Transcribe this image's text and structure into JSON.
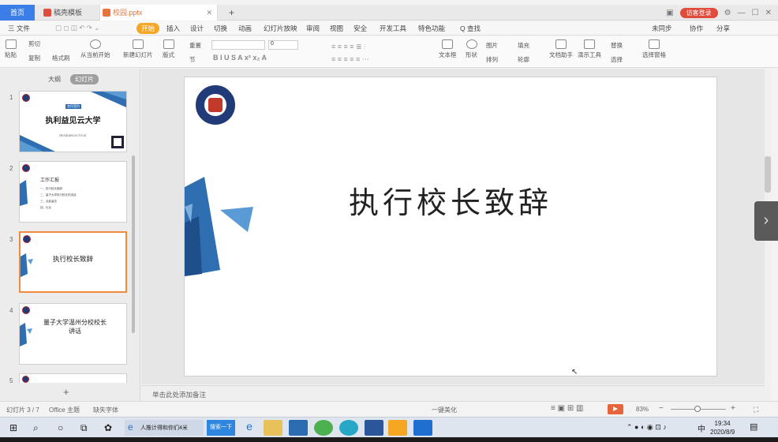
{
  "tabs": {
    "home": "首页",
    "t1": "稿壳模板",
    "t2": "校园.pptx",
    "add": "+"
  },
  "window": {
    "login": "访客登录"
  },
  "menu": {
    "file": "三 文件",
    "start": "开始",
    "items": [
      "插入",
      "设计",
      "切换",
      "动画",
      "幻灯片放映",
      "审阅",
      "视图",
      "安全",
      "开发工具",
      "特色功能",
      "Q 查找"
    ],
    "right": [
      "未同步",
      "协作",
      "分享"
    ]
  },
  "ribbon": {
    "paste": "粘贴",
    "cut": "剪切",
    "copy": "复制",
    "format": "格式刷",
    "from_current": "从当前开始",
    "new_slide": "新建幻灯片",
    "layout": "版式",
    "section": "节",
    "reset": "重置",
    "textbox": "文本框",
    "shape": "形状",
    "arrange": "排列",
    "image": "图片",
    "fill": "填充",
    "outline": "轮廓",
    "doc_helper": "文档助手",
    "presenter": "演示工具",
    "replace": "替换",
    "select": "选择",
    "select_pane": "选择窗格",
    "font_size": "0"
  },
  "panel": {
    "outline": "大纲",
    "slides": "幻灯片"
  },
  "slides": [
    {
      "num": "1",
      "title": "执利益见云大学",
      "tag": "合作签约",
      "sub": "RESEARCH TITLE"
    },
    {
      "num": "2",
      "title": "工作汇报",
      "lines": [
        "一、执行校长致辞",
        "二、量子大学执行校长的讲话",
        "三、合影留念",
        "四、礼仪"
      ]
    },
    {
      "num": "3",
      "title": "执行校长致辞"
    },
    {
      "num": "4",
      "title": "量子大学温州分校校长讲话"
    },
    {
      "num": "5"
    }
  ],
  "main_slide": {
    "title": "执行校长致辞"
  },
  "notes": "单击此处添加备注",
  "status": {
    "slide_info": "幻灯片 3 / 7",
    "theme": "Office 主题",
    "font_missing": "缺失字体",
    "beautify": "一键美化",
    "zoom": "83%"
  },
  "taskbar": {
    "start_icon": "windows-icon",
    "app_label": "人推计得和你们4米",
    "search_label": "搜索一下",
    "time": "19:34",
    "date": "2020/8/9",
    "ime": "中"
  },
  "colors": {
    "accent_blue": "#3c7ee8",
    "start_orange": "#f5a623",
    "slide_blue": "#2f6fb1",
    "selected_border": "#f08a3c"
  }
}
